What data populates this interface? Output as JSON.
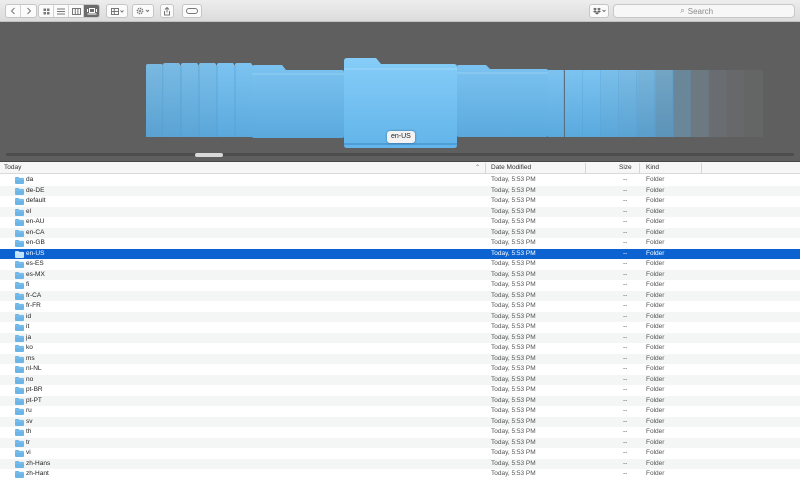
{
  "toolbar": {
    "back_icon": "chevron-left-icon",
    "forward_icon": "chevron-right-icon",
    "view_modes": [
      {
        "name": "icon-view-icon",
        "glyph": "▦"
      },
      {
        "name": "list-view-icon",
        "glyph": "≡"
      },
      {
        "name": "column-view-icon",
        "glyph": "▥"
      },
      {
        "name": "coverflow-view-icon",
        "glyph": "▭"
      }
    ],
    "active_view": "coverflow",
    "group_icon": "grid-icon",
    "action_icon": "gear-icon",
    "share_icon": "share-icon",
    "tag_icon": "tag-icon",
    "dropbox_icon": "dropbox-icon",
    "search_placeholder": "Search",
    "search_glyph": "⌕",
    "chevron_glyph": "⌄"
  },
  "coverflow": {
    "selected_label": "en-US",
    "folder_color": "#6cb5e6"
  },
  "list": {
    "headers": {
      "name": "Today",
      "date": "Date Modified",
      "size": "Size",
      "kind": "Kind",
      "sort_glyph": "⌃"
    },
    "selected_color": "#0b62d0",
    "rows": [
      {
        "name": "da",
        "date": "Today, 5:53 PM",
        "size": "--",
        "kind": "Folder"
      },
      {
        "name": "de-DE",
        "date": "Today, 5:53 PM",
        "size": "--",
        "kind": "Folder"
      },
      {
        "name": "default",
        "date": "Today, 5:53 PM",
        "size": "--",
        "kind": "Folder"
      },
      {
        "name": "el",
        "date": "Today, 5:53 PM",
        "size": "--",
        "kind": "Folder"
      },
      {
        "name": "en-AU",
        "date": "Today, 5:53 PM",
        "size": "--",
        "kind": "Folder"
      },
      {
        "name": "en-CA",
        "date": "Today, 5:53 PM",
        "size": "--",
        "kind": "Folder"
      },
      {
        "name": "en-GB",
        "date": "Today, 5:53 PM",
        "size": "--",
        "kind": "Folder"
      },
      {
        "name": "en-US",
        "date": "Today, 5:53 PM",
        "size": "--",
        "kind": "Folder",
        "selected": true
      },
      {
        "name": "es-ES",
        "date": "Today, 5:53 PM",
        "size": "--",
        "kind": "Folder"
      },
      {
        "name": "es-MX",
        "date": "Today, 5:53 PM",
        "size": "--",
        "kind": "Folder"
      },
      {
        "name": "fi",
        "date": "Today, 5:53 PM",
        "size": "--",
        "kind": "Folder"
      },
      {
        "name": "fr-CA",
        "date": "Today, 5:53 PM",
        "size": "--",
        "kind": "Folder"
      },
      {
        "name": "fr-FR",
        "date": "Today, 5:53 PM",
        "size": "--",
        "kind": "Folder"
      },
      {
        "name": "id",
        "date": "Today, 5:53 PM",
        "size": "--",
        "kind": "Folder"
      },
      {
        "name": "it",
        "date": "Today, 5:53 PM",
        "size": "--",
        "kind": "Folder"
      },
      {
        "name": "ja",
        "date": "Today, 5:53 PM",
        "size": "--",
        "kind": "Folder"
      },
      {
        "name": "ko",
        "date": "Today, 5:53 PM",
        "size": "--",
        "kind": "Folder"
      },
      {
        "name": "ms",
        "date": "Today, 5:53 PM",
        "size": "--",
        "kind": "Folder"
      },
      {
        "name": "nl-NL",
        "date": "Today, 5:53 PM",
        "size": "--",
        "kind": "Folder"
      },
      {
        "name": "no",
        "date": "Today, 5:53 PM",
        "size": "--",
        "kind": "Folder"
      },
      {
        "name": "pt-BR",
        "date": "Today, 5:53 PM",
        "size": "--",
        "kind": "Folder"
      },
      {
        "name": "pt-PT",
        "date": "Today, 5:53 PM",
        "size": "--",
        "kind": "Folder"
      },
      {
        "name": "ru",
        "date": "Today, 5:53 PM",
        "size": "--",
        "kind": "Folder"
      },
      {
        "name": "sv",
        "date": "Today, 5:53 PM",
        "size": "--",
        "kind": "Folder"
      },
      {
        "name": "th",
        "date": "Today, 5:53 PM",
        "size": "--",
        "kind": "Folder"
      },
      {
        "name": "tr",
        "date": "Today, 5:53 PM",
        "size": "--",
        "kind": "Folder"
      },
      {
        "name": "vi",
        "date": "Today, 5:53 PM",
        "size": "--",
        "kind": "Folder"
      },
      {
        "name": "zh-Hans",
        "date": "Today, 5:53 PM",
        "size": "--",
        "kind": "Folder"
      },
      {
        "name": "zh-Hant",
        "date": "Today, 5:53 PM",
        "size": "--",
        "kind": "Folder"
      }
    ]
  }
}
